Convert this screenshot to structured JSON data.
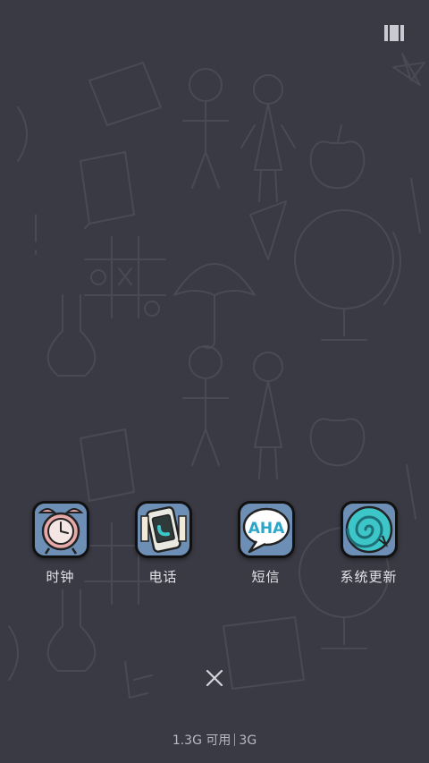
{
  "apps": [
    {
      "label": "时钟",
      "icon": "alarm-clock-icon"
    },
    {
      "label": "电话",
      "icon": "phone-icon"
    },
    {
      "label": "短信",
      "icon": "aha-speech-bubble-icon"
    },
    {
      "label": "系统更新",
      "icon": "update-swirl-icon"
    }
  ],
  "memory": {
    "available": "1.3G 可用",
    "total": "3G"
  },
  "colors": {
    "background": "#3a3a44",
    "accent": "#3cc6c8",
    "label": "#e2e2e8"
  }
}
